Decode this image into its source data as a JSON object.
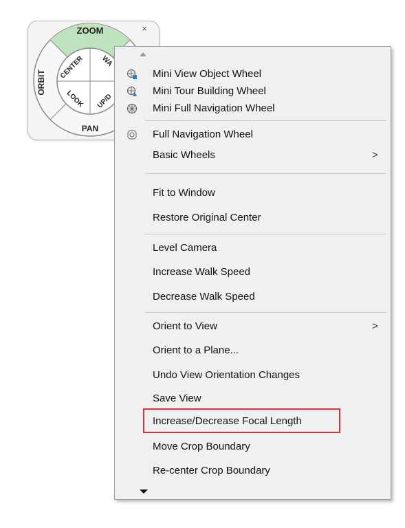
{
  "wheel": {
    "zoom": "ZOOM",
    "orbit": "ORBIT",
    "pan": "PAN",
    "center": "CENTER",
    "walk": "WA",
    "look": "LOOK",
    "updown": "UP/D",
    "close_glyph": "×"
  },
  "menu": {
    "items": [
      {
        "label": "Mini View Object Wheel",
        "icon": "mini-view-object-wheel-icon"
      },
      {
        "label": "Mini Tour Building Wheel",
        "icon": "mini-tour-building-wheel-icon"
      },
      {
        "label": "Mini Full Navigation Wheel",
        "icon": "mini-full-navigation-wheel-icon"
      },
      {
        "label": "Full Navigation Wheel",
        "icon": "full-navigation-wheel-icon"
      },
      {
        "label": "Basic Wheels",
        "submenu": true
      },
      {
        "label": "Fit to Window"
      },
      {
        "label": "Restore Original Center"
      },
      {
        "label": "Level Camera"
      },
      {
        "label": "Increase Walk Speed"
      },
      {
        "label": "Decrease Walk Speed"
      },
      {
        "label": "Orient to View",
        "submenu": true
      },
      {
        "label": "Orient to a Plane..."
      },
      {
        "label": "Undo View Orientation Changes"
      },
      {
        "label": "Save View"
      },
      {
        "label": "Increase/Decrease Focal Length",
        "highlighted": true
      },
      {
        "label": "Move Crop Boundary"
      },
      {
        "label": "Re-center Crop Boundary"
      }
    ],
    "submenu_arrow": ">"
  },
  "colors": {
    "zoom_segment": "#b9dfb9",
    "highlight_border": "#d9343d",
    "menu_bg": "#f0f0f0"
  }
}
